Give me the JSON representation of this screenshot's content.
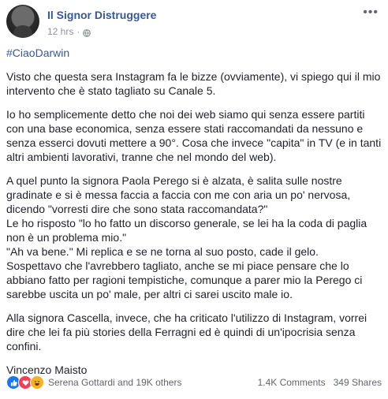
{
  "header": {
    "page_name": "Il Signor Distruggere",
    "timestamp": "12 hrs",
    "separator": "·",
    "privacy_icon": "globe-icon",
    "more_icon": "more-options-icon",
    "more_label": "•••"
  },
  "post": {
    "hashtag": "#CiaoDarwin",
    "paragraphs": [
      "Visto che questa sera Instagram fa le bizze (ovviamente), vi spiego qui il mio intervento che è stato tagliato su Canale 5.",
      "Io ho semplicemente detto che noi dei web siamo qui senza essere partiti con una base economica, senza essere stati raccomandati da nessuno e senza esserci dovuti mettere a 90°. Cosa che invece \"capita\" in TV (e in tanti altri ambienti lavorativi, tranne che nel mondo del web).",
      "A quel punto la signora Paola Perego si è alzata, è salita sulle nostre gradinate e si è messa faccia a faccia con me con aria un po' nervosa, dicendo \"vorresti dire che sono stata raccomandata?\"\nLe ho risposto \"lo ho fatto un discorso generale, se lei ha la coda di paglia non è un problema mio.\"\n\"Ah va bene.\" Mi replica e se ne torna al suo posto, cade il gelo.\nSospettavo che l'avrebbero tagliato, anche se mi piace pensare che lo abbiano fatto per ragioni tempistiche, comunque a parer mio la Perego ci sarebbe uscita un po' male, per altri ci sarei uscito male io.",
      "Alla signora Cascella, invece, che ha criticato l'utilizzo di Instagram, vorrei dire che lei fa più stories della Ferragni ed è quindi di un'ipocrisia senza confini.",
      "Vincenzo Maisto"
    ]
  },
  "footer": {
    "reaction_icons": [
      "like-icon",
      "love-icon",
      "haha-icon"
    ],
    "reaction_summary": "Serena Gottardi and 19K others",
    "comments": "1.4K Comments",
    "shares": "349 Shares"
  }
}
